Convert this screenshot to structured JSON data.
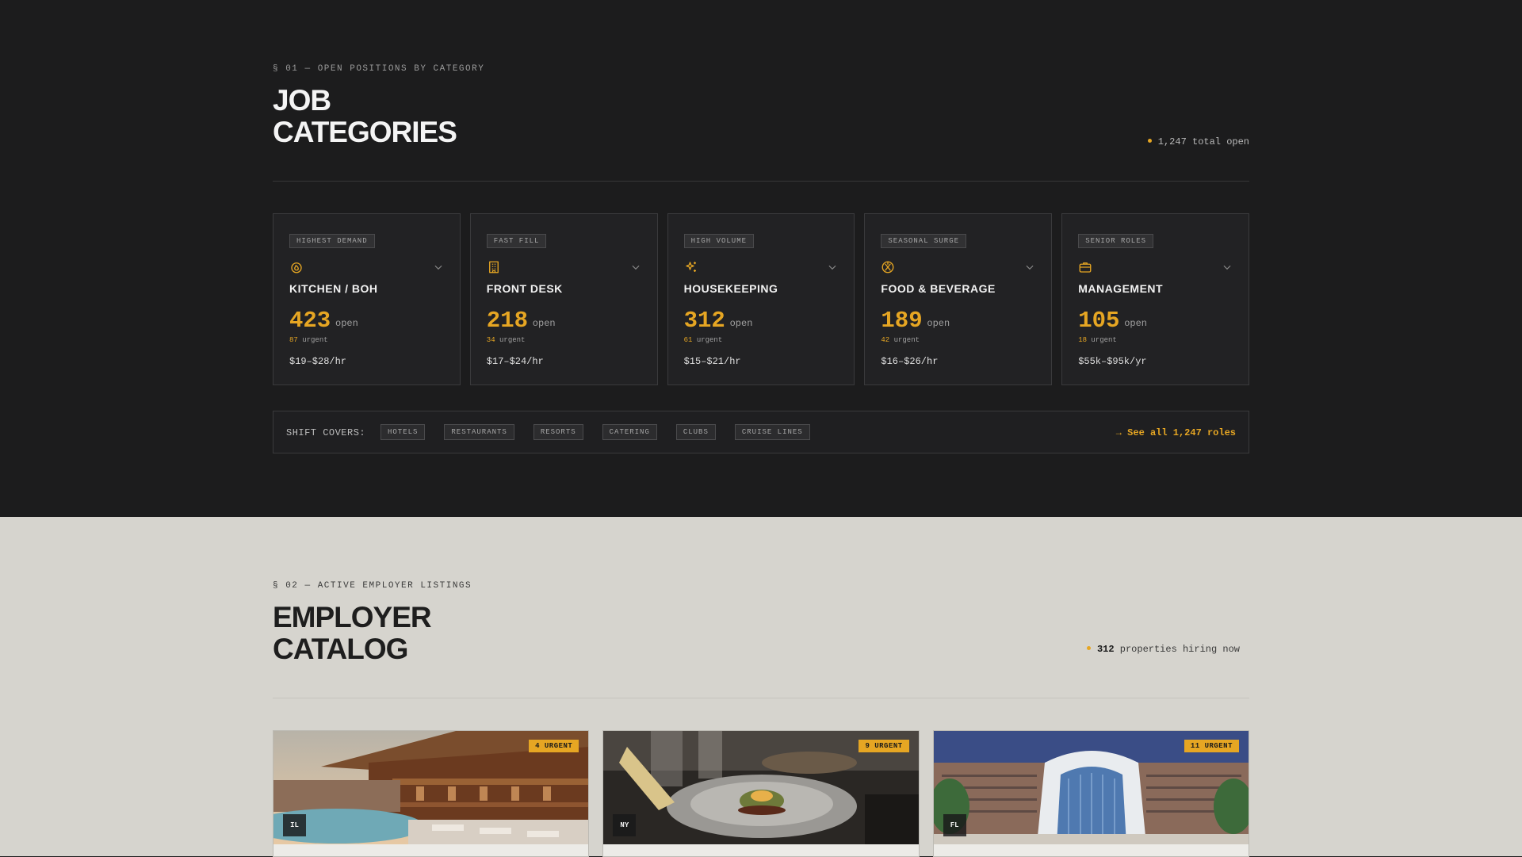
{
  "categories_section": {
    "eyebrow": "§ 01 — OPEN POSITIONS BY CATEGORY",
    "title_line1": "JOB",
    "title_line2": "CATEGORIES",
    "total_open": "1,247 total open",
    "cards": [
      {
        "badge": "HIGHEST DEMAND",
        "icon": "flame-icon",
        "name": "KITCHEN / BOH",
        "count": "423",
        "open_label": "open",
        "urgent_count": "87",
        "urgent_label": "urgent",
        "pay": "$19–$28/hr"
      },
      {
        "badge": "FAST FILL",
        "icon": "building-icon",
        "name": "FRONT DESK",
        "count": "218",
        "open_label": "open",
        "urgent_count": "34",
        "urgent_label": "urgent",
        "pay": "$17–$24/hr"
      },
      {
        "badge": "HIGH VOLUME",
        "icon": "sparkles-icon",
        "name": "HOUSEKEEPING",
        "count": "312",
        "open_label": "open",
        "urgent_count": "61",
        "urgent_label": "urgent",
        "pay": "$15–$21/hr"
      },
      {
        "badge": "SEASONAL SURGE",
        "icon": "utensils-circle-icon",
        "name": "FOOD & BEVERAGE",
        "count": "189",
        "open_label": "open",
        "urgent_count": "42",
        "urgent_label": "urgent",
        "pay": "$16–$26/hr"
      },
      {
        "badge": "SENIOR ROLES",
        "icon": "briefcase-icon",
        "name": "MANAGEMENT",
        "count": "105",
        "open_label": "open",
        "urgent_count": "18",
        "urgent_label": "urgent",
        "pay": "$55k–$95k/yr"
      }
    ],
    "shift_covers": {
      "label": "SHIFT COVERS:",
      "tags": [
        "HOTELS",
        "RESTAURANTS",
        "RESORTS",
        "CATERING",
        "CLUBS",
        "CRUISE LINES"
      ],
      "see_all": "→ See all 1,247 roles"
    }
  },
  "employer_section": {
    "eyebrow": "§ 02 — ACTIVE EMPLOYER LISTINGS",
    "title_line1": "EMPLOYER",
    "title_line2": "CATALOG",
    "hiring_count": "312",
    "hiring_label": "properties hiring now",
    "listings": [
      {
        "urgent": "4 URGENT",
        "state": "IL"
      },
      {
        "urgent": "9 URGENT",
        "state": "NY"
      },
      {
        "urgent": "11 URGENT",
        "state": "FL"
      }
    ]
  },
  "colors": {
    "accent": "#e6a623",
    "dark_bg": "#1c1c1d",
    "light_bg": "#d6d4ce"
  }
}
